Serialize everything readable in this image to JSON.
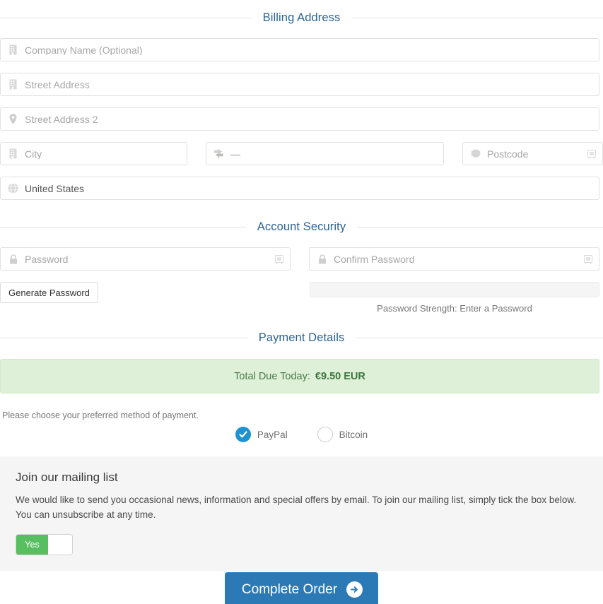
{
  "sections": {
    "billing": "Billing Address",
    "security": "Account Security",
    "payment": "Payment Details"
  },
  "billing": {
    "company": {
      "placeholder": "Company Name (Optional)",
      "value": "",
      "icon": "building-icon"
    },
    "street1": {
      "placeholder": "Street Address",
      "value": "",
      "icon": "building-icon"
    },
    "street2": {
      "placeholder": "Street Address 2",
      "value": "",
      "icon": "map-marker-icon"
    },
    "city": {
      "placeholder": "City",
      "value": "",
      "icon": "building-icon"
    },
    "state": {
      "placeholder": "",
      "value": "—",
      "icon": "map-signs-icon"
    },
    "postcode": {
      "placeholder": "Postcode",
      "value": "",
      "icon": "certificate-icon",
      "autofill_icon": "autofill-icon"
    },
    "country": {
      "placeholder": "",
      "value": "United States",
      "icon": "globe-icon"
    }
  },
  "security": {
    "password": {
      "placeholder": "Password",
      "value": "",
      "icon": "lock-icon",
      "autofill_icon": "key-manager-icon"
    },
    "confirm_password": {
      "placeholder": "Confirm Password",
      "value": "",
      "icon": "lock-icon",
      "autofill_icon": "key-manager-icon"
    },
    "generate_button": "Generate Password",
    "strength_label": "Password Strength: Enter a Password",
    "strength_percent": 0
  },
  "payment": {
    "total_label": "Total Due Today:",
    "total_amount": "€9.50 EUR",
    "note": "Please choose your preferred method of payment.",
    "methods": [
      {
        "label": "PayPal",
        "selected": true
      },
      {
        "label": "Bitcoin",
        "selected": false
      }
    ]
  },
  "mailing": {
    "title": "Join our mailing list",
    "body": "We would like to send you occasional news, information and special offers by email. To join our mailing list, simply tick the box below. You can unsubscribe at any time.",
    "toggle_on_label": "Yes",
    "toggle_state": "on"
  },
  "submit": {
    "label": "Complete Order",
    "icon": "arrow-circle-right-icon"
  },
  "colors": {
    "heading": "#2a6496",
    "accent_blue": "#2c7ab5",
    "radio_blue": "#1f92d0",
    "toggle_green": "#57bf60",
    "alert_bg": "#dff0d8",
    "alert_text": "#3c763d",
    "panel_bg": "#f5f5f5",
    "border": "#e1e1e1"
  }
}
